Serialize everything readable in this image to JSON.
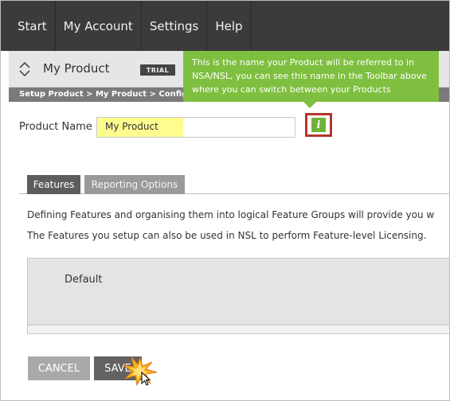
{
  "nav": {
    "items": [
      "Start",
      "My Account",
      "Settings",
      "Help"
    ]
  },
  "product_bar": {
    "name": "My Product",
    "badge": "TRIAL"
  },
  "breadcrumb": "Setup Product > My Product > Configure",
  "tooltip": {
    "lines": [
      "This is the name your Product will be referred to in",
      "NSA/NSL, you can see this name in the Toolbar above",
      "where you can switch between your Products"
    ]
  },
  "form": {
    "product_name_label": "Product Name",
    "product_name_value": "My Product",
    "info_icon_glyph": "i"
  },
  "tabs": [
    "Features",
    "Reporting Options"
  ],
  "description": {
    "line1": "Defining Features and organising them into logical Feature Groups will provide you w",
    "line2": "The Features you setup can also be used in NSL to perform Feature-level Licensing."
  },
  "feature_groups": [
    "Default"
  ],
  "buttons": {
    "cancel": "CANCEL",
    "save": "SAVE"
  },
  "colors": {
    "nav_bg": "#3b3b3b",
    "tooltip_bg": "#7fbf3f",
    "info_border": "#b3362a",
    "highlight": "#fdfc8e"
  }
}
